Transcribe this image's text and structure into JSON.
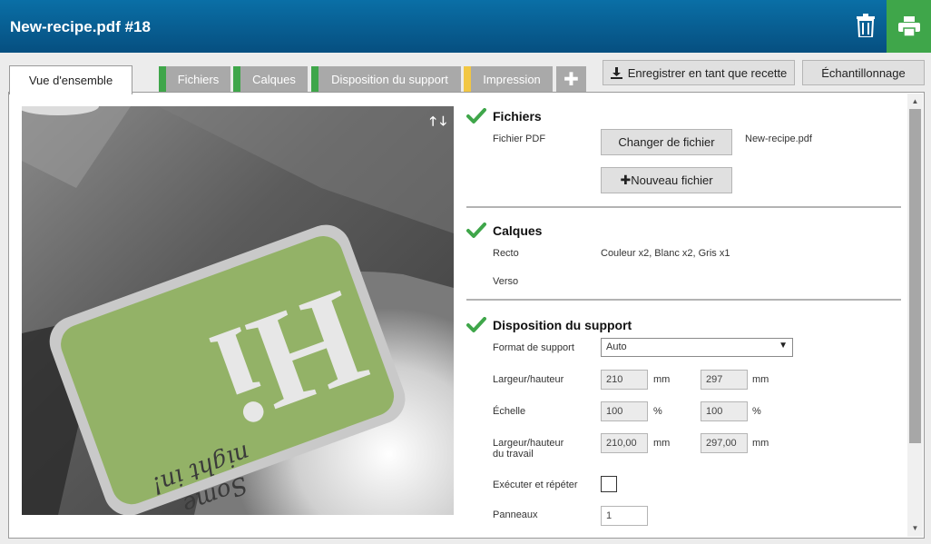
{
  "header": {
    "title": "New-recipe.pdf #18"
  },
  "icons": {
    "trash": "trash-icon",
    "print": "printer-icon",
    "plus": "plus-icon",
    "check": "checkmark-icon"
  },
  "colors": {
    "header": "#0a6fa6",
    "print_button": "#3fa64a",
    "tab_ok": "#3fa64a",
    "tab_warn": "#f2c744",
    "tab_inactive": "#a9a9a9"
  },
  "tabs": [
    {
      "label": "Vue d'ensemble",
      "status": "active"
    },
    {
      "label": "Fichiers",
      "status": "ok"
    },
    {
      "label": "Calques",
      "status": "ok"
    },
    {
      "label": "Disposition du support",
      "status": "ok"
    },
    {
      "label": "Impression",
      "status": "warning"
    }
  ],
  "toolbar": {
    "save_recipe": "Enregistrer en tant que recette",
    "sampling": "Échantillonnage"
  },
  "preview": {
    "arrows_up": "🡑",
    "arrows_down": "🡓",
    "card_text": "Hi",
    "card_script_1": "Some",
    "card_script_2": "night in!"
  },
  "files": {
    "title": "Fichiers",
    "pdf_label": "Fichier PDF",
    "change_button": "Changer de fichier",
    "filename": "New-recipe.pdf",
    "new_button": "Nouveau fichier"
  },
  "layers": {
    "title": "Calques",
    "recto_label": "Recto",
    "recto_value": "Couleur x2, Blanc x2, Gris x1",
    "verso_label": "Verso"
  },
  "layout": {
    "title": "Disposition du support",
    "format_label": "Format de support",
    "format_value": "Auto",
    "size_label": "Largeur/hauteur",
    "width": "210",
    "height": "297",
    "unit_mm": "mm",
    "scale_label": "Échelle",
    "scale_x": "100",
    "scale_y": "100",
    "unit_pct": "%",
    "job_size_label_1": "Largeur/hauteur",
    "job_size_label_2": "du travail",
    "job_width": "210,00",
    "job_height": "297,00",
    "step_repeat_label": "Exécuter et répéter",
    "panels_label": "Panneaux",
    "panels_value": "1"
  }
}
